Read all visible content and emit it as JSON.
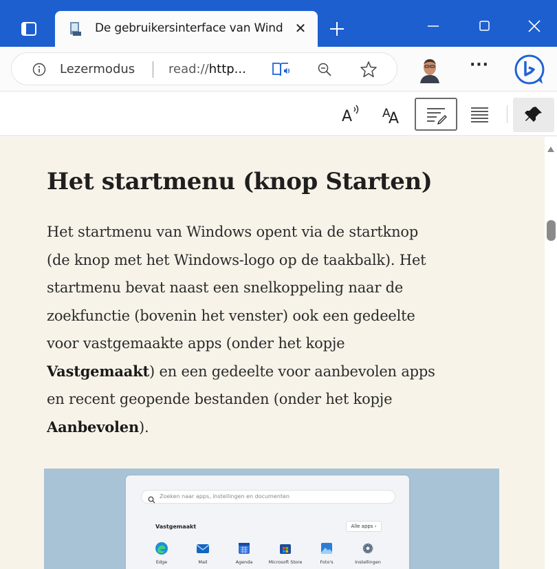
{
  "window": {
    "tab_title": "De gebruikersinterface van Wind",
    "tab_close": "✕",
    "controls": {
      "minimize": "minimize",
      "maximize": "maximize",
      "close": "close"
    }
  },
  "navbar": {
    "reader_mode_label": "Lezermodus",
    "url_prefix": "read://",
    "url_rest": "http...",
    "more_label": "···"
  },
  "reader_toolbar": {
    "items": [
      "read-aloud-icon",
      "text-preferences-icon",
      "reading-preferences-icon",
      "grammar-tools-icon",
      "pin-icon"
    ],
    "selected": "reading-preferences-icon"
  },
  "article": {
    "heading": "Het startmenu (knop Starten)",
    "paragraph": {
      "l1": "Het startmenu van Windows opent via de startknop",
      "l2": "(de knop met het Windows-logo op de taakbalk). Het",
      "l3": "startmenu bevat naast een snelkoppeling naar de",
      "l4": "zoekfunctie (bovenin het venster) ook een gedeelte",
      "l5": "voor vastgemaakte apps (onder het kopje",
      "l6_bold": "Vastgemaakt",
      "l6_rest": ") en een gedeelte voor aanbevolen apps",
      "l7": "en recent geopende bestanden (onder het kopje",
      "l8_bold": "Aanbevolen",
      "l8_rest": ")."
    },
    "figure": {
      "search_placeholder": "Zoeken naar apps, instellingen en documenten",
      "pinned_heading": "Vastgemaakt",
      "all_apps_label": "Alle apps  ›",
      "apps": [
        {
          "label": "Edge",
          "color": "#1d8fd8"
        },
        {
          "label": "Mail",
          "color": "#1565c0"
        },
        {
          "label": "Agenda",
          "color": "#2f6fd6"
        },
        {
          "label": "Microsoft Store",
          "color": "#1f4c9a"
        },
        {
          "label": "Foto's",
          "color": "#2d7dd2"
        },
        {
          "label": "Instellingen",
          "color": "#5a6a80"
        }
      ]
    }
  },
  "colors": {
    "titlebar": "#1e5fd0",
    "reader_background": "#f7f3e9",
    "figure_background": "#a8c2d6"
  }
}
